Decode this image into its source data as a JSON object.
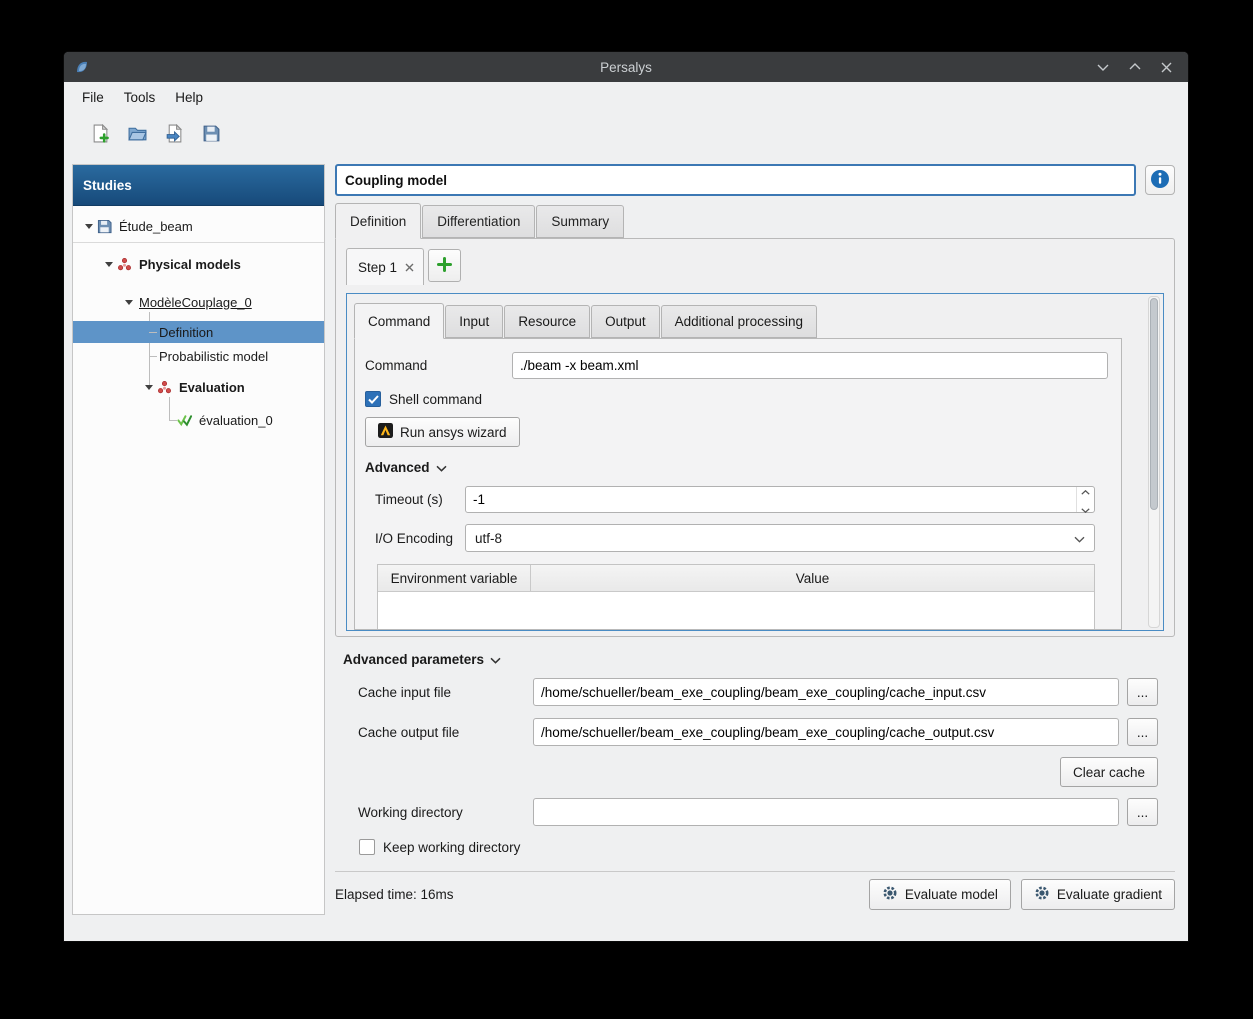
{
  "colors": {
    "accent_blue": "#3c78b4",
    "selection_blue": "#5e94c8",
    "studies_header_blue": "#1d5a92",
    "info_blue": "#1c6cb5",
    "plus_green": "#2da02d",
    "check_green": "#3fa33f",
    "model_icon_red": "#d14b4b",
    "ansys_gold": "#ffb71b"
  },
  "window": {
    "title": "Persalys"
  },
  "menubar": {
    "file": "File",
    "tools": "Tools",
    "help": "Help"
  },
  "sidebar": {
    "header": "Studies",
    "tree": {
      "study": "Étude_beam",
      "physical_models": "Physical models",
      "model": "ModèleCouplage_0",
      "definition": "Definition",
      "probabilistic_model": "Probabilistic model",
      "evaluation": "Evaluation",
      "evaluation_item": "évaluation_0"
    }
  },
  "main": {
    "model_name": "Coupling model",
    "tabs": {
      "definition": "Definition",
      "differentiation": "Differentiation",
      "summary": "Summary"
    },
    "steps": {
      "step1": "Step 1"
    },
    "inner_tabs": {
      "command": "Command",
      "input": "Input",
      "resource": "Resource",
      "output": "Output",
      "additional": "Additional processing"
    },
    "command": {
      "label": "Command",
      "value": "./beam -x beam.xml"
    },
    "shell_command": {
      "label": "Shell command",
      "checked": true
    },
    "wizard_button": "Run ansys wizard",
    "advanced": {
      "label": "Advanced",
      "timeout_label": "Timeout (s)",
      "timeout_value": "-1",
      "encoding_label": "I/O Encoding",
      "encoding_value": "utf-8",
      "env_col1": "Environment variable",
      "env_col2": "Value"
    },
    "advanced_params": {
      "label": "Advanced parameters",
      "cache_input_label": "Cache input file",
      "cache_input_value": "/home/schueller/beam_exe_coupling/beam_exe_coupling/cache_input.csv",
      "cache_output_label": "Cache output file",
      "cache_output_value": "/home/schueller/beam_exe_coupling/beam_exe_coupling/cache_output.csv",
      "browse": "...",
      "clear_cache": "Clear cache",
      "working_dir_label": "Working directory",
      "working_dir_value": "",
      "keep_working_dir": {
        "label": "Keep working directory",
        "checked": false
      }
    },
    "footer": {
      "elapsed": "Elapsed time: 16ms",
      "evaluate_model": "Evaluate model",
      "evaluate_gradient": "Evaluate gradient"
    }
  }
}
